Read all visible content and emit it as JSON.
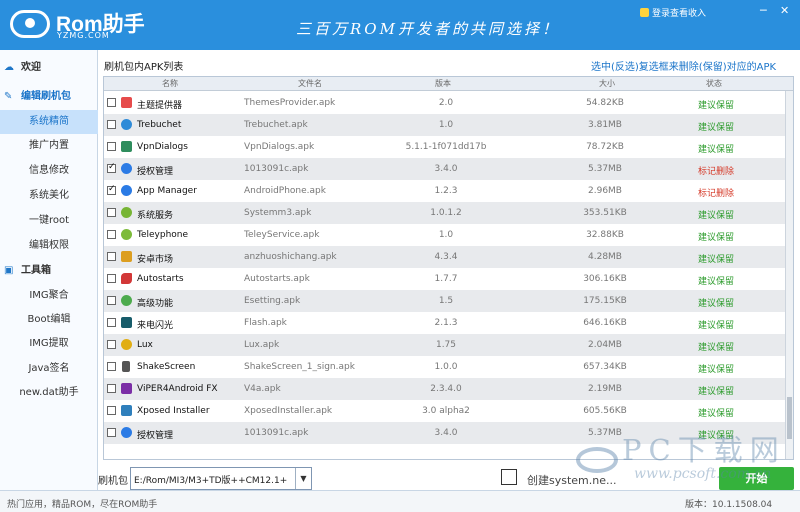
{
  "header": {
    "logo_text": "Rom助手",
    "logo_subtitle": "YZMG.COM",
    "slogan": "三百万ROM开发者的共同选择！",
    "login_text": "登录查看收入",
    "minimize": "─",
    "close": "✕"
  },
  "sidebar": {
    "group1": "欢迎",
    "group2": "编辑刷机包",
    "group3": "工具箱",
    "items2": [
      "系统精简",
      "推广内置",
      "信息修改",
      "系统美化",
      "一键root",
      "编辑权限"
    ],
    "items3": [
      "IMG聚合",
      "Boot编辑",
      "IMG提取",
      "Java签名",
      "new.dat助手"
    ]
  },
  "main": {
    "title": "刷机包内APK列表",
    "hint": "选中(反选)复选框来删除(保留)对应的APK"
  },
  "table": {
    "headers": [
      "名称",
      "文件名",
      "版本",
      "大小",
      "状态"
    ],
    "rows": [
      {
        "name": "主题提供器",
        "file": "ThemesProvider.apk",
        "version": "2.0",
        "size": "54.82KB",
        "status": "建议保留",
        "checked": false,
        "icon": "theme-icon",
        "color": "#e64b4b"
      },
      {
        "name": "Trebuchet",
        "file": "Trebuchet.apk",
        "version": "1.0",
        "size": "3.81MB",
        "status": "建议保留",
        "checked": false,
        "icon": "launcher-icon",
        "color": "#2e8bd8"
      },
      {
        "name": "VpnDialogs",
        "file": "VpnDialogs.apk",
        "version": "5.1.1-1f071dd17b",
        "size": "78.72KB",
        "status": "建议保留",
        "checked": false,
        "icon": "vpn-icon",
        "color": "#2f8d5d"
      },
      {
        "name": "授权管理",
        "file": "1013091c.apk",
        "version": "3.4.0",
        "size": "5.37MB",
        "status": "标记删除",
        "checked": true,
        "icon": "permission-icon",
        "color": "#2b7be5"
      },
      {
        "name": "App Manager",
        "file": "AndroidPhone.apk",
        "version": "1.2.3",
        "size": "2.96MB",
        "status": "标记删除",
        "checked": true,
        "icon": "app-manager-icon",
        "color": "#2b7be5"
      },
      {
        "name": "系统服务",
        "file": "Systemm3.apk",
        "version": "1.0.1.2",
        "size": "353.51KB",
        "status": "建议保留",
        "checked": false,
        "icon": "gear-icon",
        "color": "#77b534"
      },
      {
        "name": "Teleyphone",
        "file": "TeleyService.apk",
        "version": "1.0",
        "size": "32.88KB",
        "status": "建议保留",
        "checked": false,
        "icon": "android-icon",
        "color": "#7dbb3a"
      },
      {
        "name": "安卓市场",
        "file": "anzhuoshichang.apk",
        "version": "4.3.4",
        "size": "4.28MB",
        "status": "建议保留",
        "checked": false,
        "icon": "market-icon",
        "color": "#dc9e20"
      },
      {
        "name": "Autostarts",
        "file": "Autostarts.apk",
        "version": "1.7.7",
        "size": "306.16KB",
        "status": "建议保留",
        "checked": false,
        "icon": "car-icon",
        "color": "#d23737"
      },
      {
        "name": "高级功能",
        "file": "Esetting.apk",
        "version": "1.5",
        "size": "175.15KB",
        "status": "建议保留",
        "checked": false,
        "icon": "advanced-icon",
        "color": "#4dab4d"
      },
      {
        "name": "来电闪光",
        "file": "Flash.apk",
        "version": "2.1.3",
        "size": "646.16KB",
        "status": "建议保留",
        "checked": false,
        "icon": "flash-icon",
        "color": "#175c6a"
      },
      {
        "name": "Lux",
        "file": "Lux.apk",
        "version": "1.75",
        "size": "2.04MB",
        "status": "建议保留",
        "checked": false,
        "icon": "lux-icon",
        "color": "#e1ae13"
      },
      {
        "name": "ShakeScreen",
        "file": "ShakeScreen_1_sign.apk",
        "version": "1.0.0",
        "size": "657.34KB",
        "status": "建议保留",
        "checked": false,
        "icon": "lock-icon",
        "color": "#555555"
      },
      {
        "name": "ViPER4Android FX",
        "file": "V4a.apk",
        "version": "2.3.4.0",
        "size": "2.19MB",
        "status": "建议保留",
        "checked": false,
        "icon": "viper-icon",
        "color": "#7b2ea6"
      },
      {
        "name": "Xposed Installer",
        "file": "XposedInstaller.apk",
        "version": "3.0 alpha2",
        "size": "605.56KB",
        "status": "建议保留",
        "checked": false,
        "icon": "xposed-icon",
        "color": "#2f7fbc"
      },
      {
        "name": "授权管理",
        "file": "1013091c.apk",
        "version": "3.4.0",
        "size": "5.37MB",
        "status": "建议保留",
        "checked": false,
        "icon": "permission-icon",
        "color": "#2b7be5"
      }
    ]
  },
  "bottom": {
    "package_label": "刷机包",
    "package_path": "E:/Rom/MI3/M3+TD版++CM12.1+",
    "create_label": "创建system.ne...",
    "start_button": "开始"
  },
  "watermark": {
    "text": "PC下载网",
    "url": "www.pcsoft.com.cn"
  },
  "footer": {
    "left": "热门应用，精品ROM，尽在ROM助手",
    "version": "版本：10.1.1508.04"
  }
}
